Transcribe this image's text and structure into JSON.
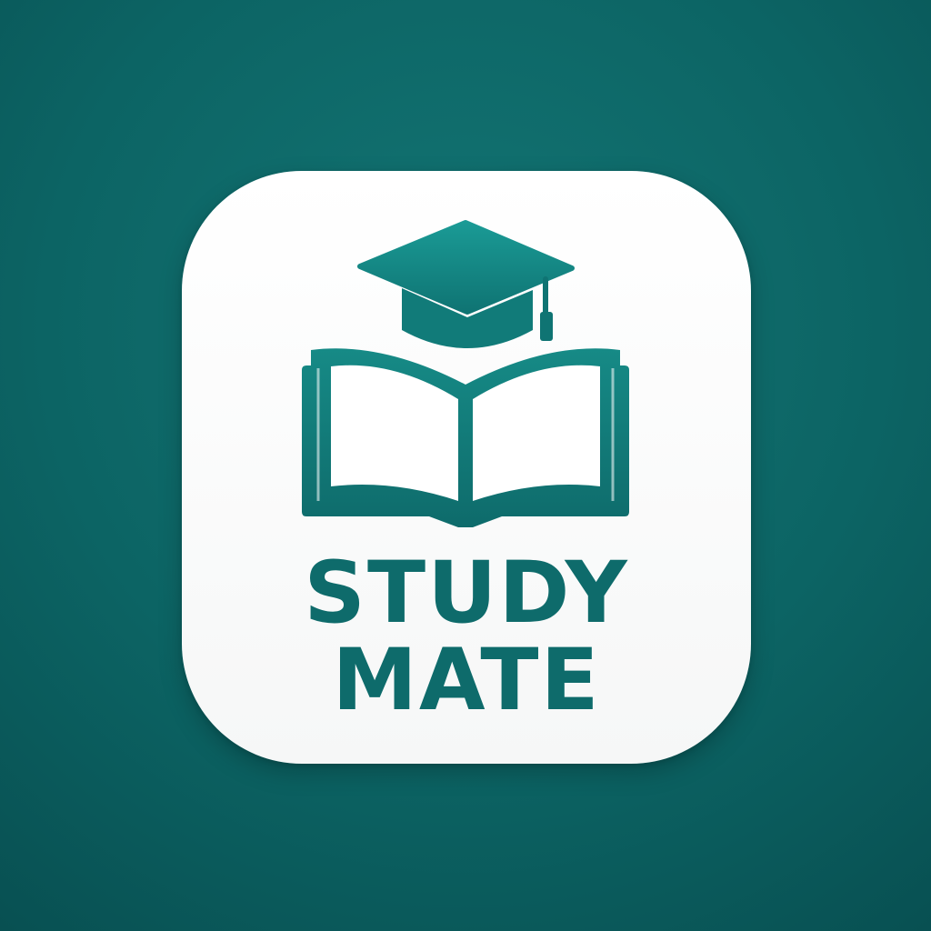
{
  "app_icon": {
    "name_line1": "STUDY",
    "name_line2": "MATE",
    "icons": [
      "graduation-cap-icon",
      "open-book-icon"
    ],
    "colors": {
      "brand_teal": "#0e6b6b",
      "cap_teal_light": "#1a9a95",
      "background_teal": "#0c6464",
      "tile_white": "#ffffff"
    }
  }
}
